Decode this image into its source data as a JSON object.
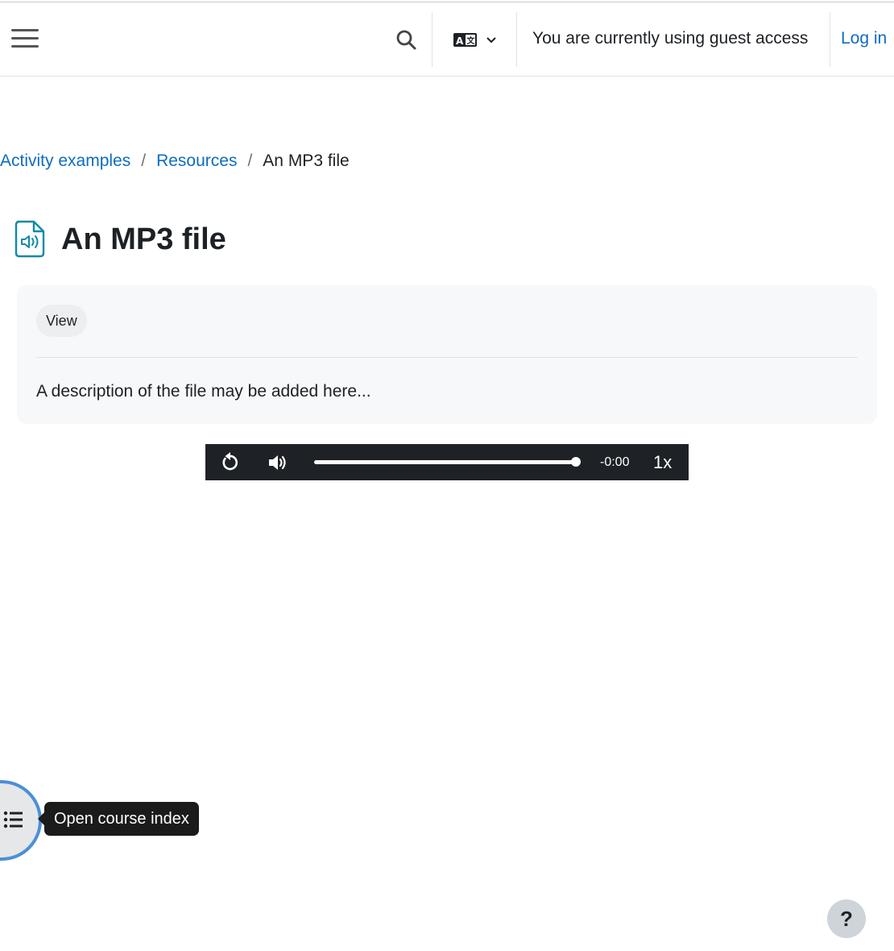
{
  "header": {
    "menu_icon": "hamburger-menu-icon",
    "search_icon": "search-icon",
    "language_icon": "language-icon",
    "guest_notice": "You are currently using guest access",
    "login_label": "Log in"
  },
  "breadcrumb": {
    "items": [
      "Activity examples",
      "Resources"
    ],
    "separator": "/",
    "current": "An MP3 file"
  },
  "page": {
    "title": "An MP3 file",
    "icon": "audio-file-icon"
  },
  "activity": {
    "view_label": "View",
    "description": "A description of the file may be added here..."
  },
  "player": {
    "time": "-0:00",
    "speed": "1x",
    "progress": 1.0
  },
  "course_index": {
    "tooltip": "Open course index",
    "icon": "list-icon"
  },
  "help": {
    "label": "?"
  },
  "colors": {
    "link": "#0f6cbf",
    "icon_teal": "#0e8ba7",
    "player_bg": "#1e2126",
    "focus_ring": "#4a8fd8"
  }
}
